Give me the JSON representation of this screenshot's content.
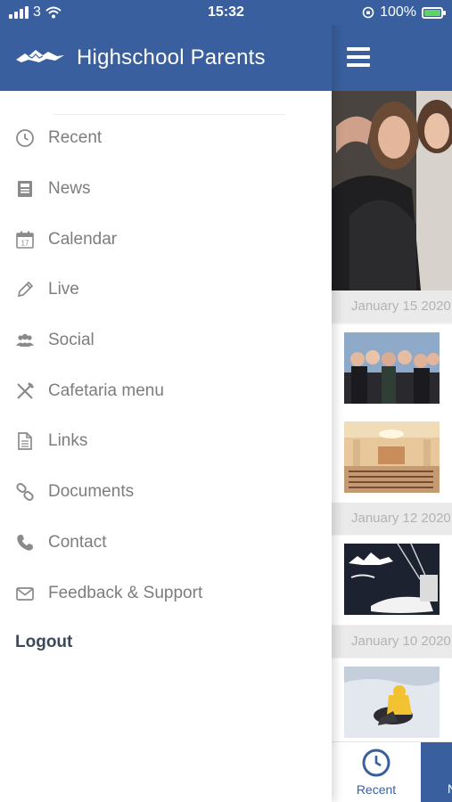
{
  "status_bar": {
    "carrier": "3",
    "time": "15:32",
    "battery_percent": "100%",
    "battery_level": 1.0
  },
  "drawer": {
    "title": "Highschool Parents",
    "logo_icon": "mountain-logo-icon",
    "items": [
      {
        "label": "Recent",
        "icon": "clock-icon"
      },
      {
        "label": "News",
        "icon": "newspaper-icon"
      },
      {
        "label": "Calendar",
        "icon": "calendar-icon"
      },
      {
        "label": "Live",
        "icon": "pencil-icon"
      },
      {
        "label": "Social",
        "icon": "people-icon"
      },
      {
        "label": "Cafetaria menu",
        "icon": "utensils-icon"
      },
      {
        "label": "Links",
        "icon": "document-icon"
      },
      {
        "label": "Documents",
        "icon": "link-icon"
      },
      {
        "label": "Contact",
        "icon": "phone-icon"
      },
      {
        "label": "Feedback & Support",
        "icon": "envelope-icon"
      }
    ],
    "logout_label": "Logout"
  },
  "content": {
    "dates": [
      "January 15 2020",
      "January 12 2020",
      "January 10 2020"
    ],
    "calendar_day": "17",
    "bottom_tabs": {
      "recent_label": "Recent",
      "next_label": "N"
    }
  },
  "colors": {
    "primary": "#3a5f9e",
    "menu_text": "#7d7d7d",
    "logout_text": "#3b4a5a",
    "battery": "#5fd35f"
  }
}
